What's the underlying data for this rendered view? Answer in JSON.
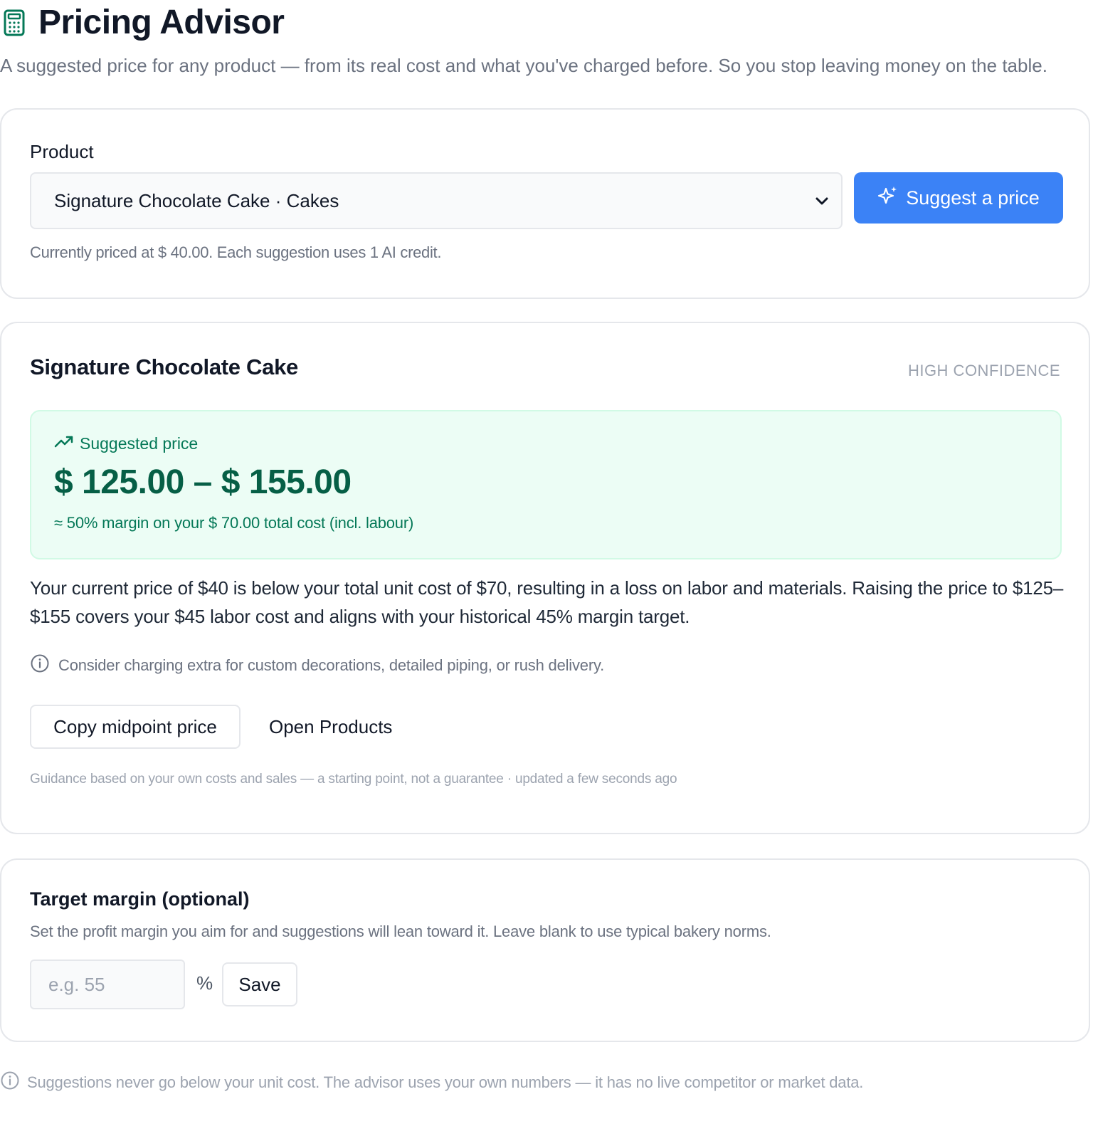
{
  "header": {
    "title": "Pricing Advisor",
    "subtitle": "A suggested price for any product — from its real cost and what you've charged before. So you stop leaving money on the table."
  },
  "product_card": {
    "label": "Product",
    "selected_product": "Signature Chocolate Cake · Cakes",
    "suggest_button": "Suggest a price",
    "hint": "Currently priced at $ 40.00. Each suggestion uses 1 AI credit."
  },
  "result_card": {
    "product_name": "Signature Chocolate Cake",
    "confidence": "HIGH CONFIDENCE",
    "suggested_label": "Suggested price",
    "price_range": "$ 125.00 – $ 155.00",
    "margin_note": "≈ 50% margin on your $ 70.00 total cost (incl. labour)",
    "explanation": "Your current price of $40 is below your total unit cost of $70, resulting in a loss on labor and materials. Raising the price to $125–$155 covers your $45 labor cost and aligns with your historical 45% margin target.",
    "tip": "Consider charging extra for custom decorations, detailed piping, or rush delivery.",
    "copy_button": "Copy midpoint price",
    "open_products_link": "Open Products",
    "footnote": "Guidance based on your own costs and sales — a starting point, not a guarantee · updated a few seconds ago"
  },
  "margin_card": {
    "title": "Target margin (optional)",
    "description": "Set the profit margin you aim for and suggestions will lean toward it. Leave blank to use typical bakery norms.",
    "input_value": "",
    "input_placeholder": "e.g. 55",
    "unit": "%",
    "save_button": "Save"
  },
  "bottom_note": "Suggestions never go below your unit cost. The advisor uses your own numbers — it has no live competitor or market data.",
  "colors": {
    "accent": "#3b82f6",
    "brand_green": "#047857",
    "success_bg": "#ecfdf5",
    "muted_text": "#6b7280"
  },
  "icons": {
    "header": "calculator-icon",
    "suggest": "sparkles-icon",
    "trend": "trending-up-icon",
    "info": "info-icon",
    "dropdown": "chevron-down-icon"
  }
}
